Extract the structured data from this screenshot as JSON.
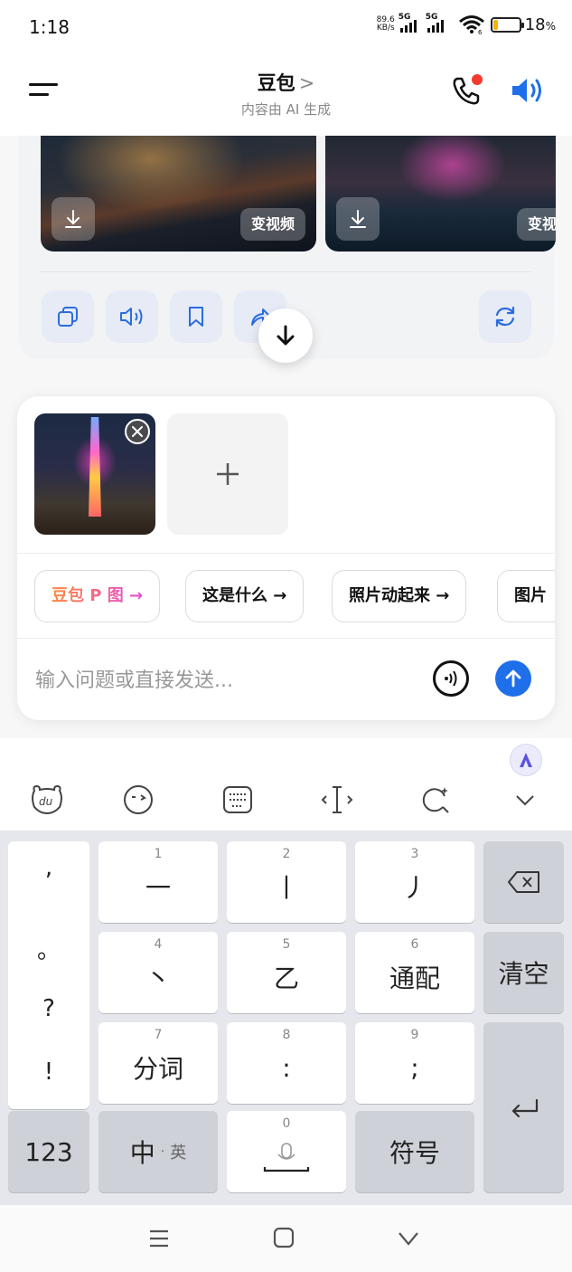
{
  "status_bar": {
    "time": "1:18",
    "net_speed_value": "89.6",
    "net_speed_unit": "KB/s",
    "signal1_label": "5G",
    "signal2_label": "5G",
    "wifi_badge": "6",
    "battery_percent": "18",
    "battery_unit": "%",
    "battery_level": 0.18
  },
  "header": {
    "title": "豆包",
    "title_chevron": ">",
    "subtitle": "内容由 AI 生成"
  },
  "message_card": {
    "images": [
      {
        "video_button": "变视频"
      },
      {
        "video_button": "变视"
      }
    ],
    "actions": [
      "copy-icon",
      "read-aloud-icon",
      "bookmark-icon",
      "share-icon",
      "regenerate-icon"
    ]
  },
  "composer": {
    "suggestions": [
      {
        "label": "豆包 P 图 →"
      },
      {
        "label": "这是什么 →"
      },
      {
        "label": "照片动起来 →"
      },
      {
        "label": "图片"
      }
    ],
    "placeholder": "输入问题或直接发送..."
  },
  "keyboard": {
    "punctuation": [
      ",",
      "。",
      "?",
      "!"
    ],
    "keys": [
      {
        "num": "1",
        "main": "一"
      },
      {
        "num": "2",
        "main": "丨"
      },
      {
        "num": "3",
        "main": "丿"
      },
      {
        "num": "4",
        "main": "丶"
      },
      {
        "num": "5",
        "main": "乙"
      },
      {
        "num": "6",
        "main": "通配"
      },
      {
        "num": "7",
        "main": "分词"
      },
      {
        "num": "8",
        "main": ":"
      },
      {
        "num": "9",
        "main": ";"
      },
      {
        "num": "0",
        "main": ""
      }
    ],
    "clear": "清空",
    "numbers": "123",
    "lang_main": "中",
    "lang_sep": "·",
    "lang_alt": "英",
    "symbols": "符号"
  },
  "colors": {
    "accent": "#1f6feb",
    "notification": "#f33a2f",
    "key_gray": "#cfd1d8"
  }
}
